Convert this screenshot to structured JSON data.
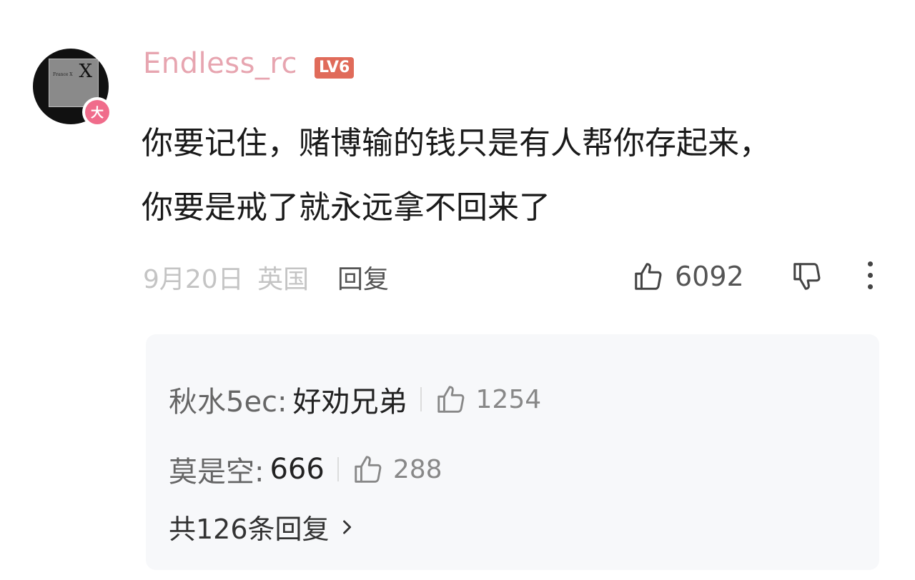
{
  "comment": {
    "username": "Endless_rc",
    "level_badge": "LV6",
    "avatar_badge": "大",
    "avatar_card_text": "X",
    "avatar_card_small": "France X",
    "text_lines": "你要记住，赌博输的钱只是有人帮你存起来，\n你要是戒了就永远拿不回来了",
    "date": "9月20日",
    "location": "英国",
    "reply_label": "回复",
    "like_count": "6092"
  },
  "replies": [
    {
      "name": "秋水5ec:",
      "text": "好劝兄弟",
      "likes": "1254"
    },
    {
      "name": "莫是空:",
      "text": "666",
      "likes": "288"
    }
  ],
  "more_replies_label": "共126条回复",
  "colors": {
    "username": "#e7a5b0",
    "level_badge": "#e06b5a",
    "avatar_badge": "#f06c8b",
    "reply_box_bg": "#f7f8fa"
  },
  "icons": {
    "like": "thumb-up-icon",
    "dislike": "thumb-down-icon",
    "more": "more-vertical-icon",
    "chevron": "chevron-right-icon"
  }
}
